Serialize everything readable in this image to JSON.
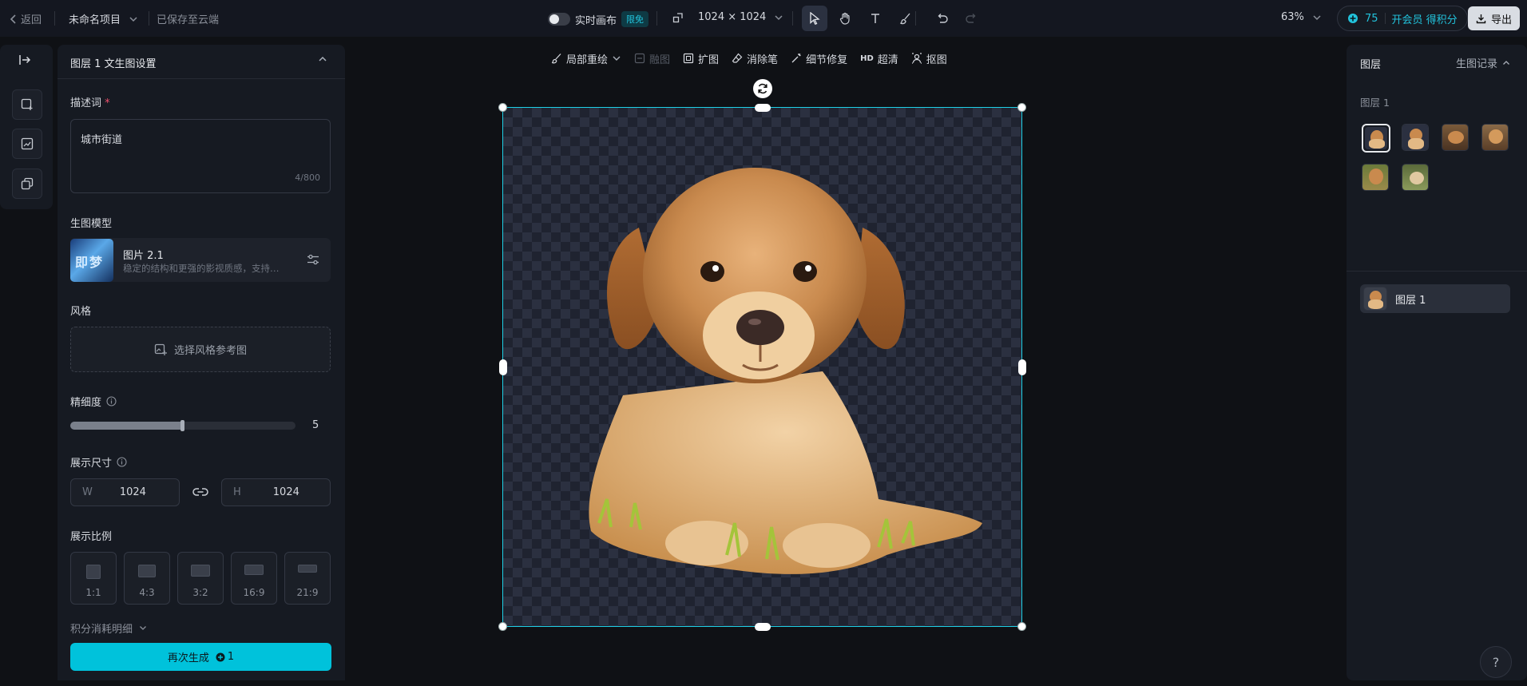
{
  "header": {
    "back_label": "返回",
    "project_name": "未命名项目",
    "save_status": "已保存至云端",
    "realtime_canvas_label": "实时画布",
    "free_badge": "限免",
    "canvas_size": "1024 × 1024",
    "zoom": "63%",
    "points": "75",
    "vip_label": "开会员 得积分",
    "export_label": "导出"
  },
  "left_panel": {
    "title": "图层 1 文生图设置",
    "prompt_label": "描述词",
    "required_mark": "*",
    "prompt_value": "城市街道",
    "prompt_count": "4/800",
    "model_label": "生图模型",
    "model_name": "图片 2.1",
    "model_desc": "稳定的结构和更强的影视质感，支持…",
    "model_thumb_text": "即梦",
    "style_label": "风格",
    "style_button": "选择风格参考图",
    "detail_label": "精细度",
    "detail_value": "5",
    "detail_fraction": 0.5,
    "size_label": "展示尺寸",
    "width_prefix": "W",
    "width_value": "1024",
    "height_prefix": "H",
    "height_value": "1024",
    "ratio_label": "展示比例",
    "ratios": [
      "1:1",
      "4:3",
      "3:2",
      "16:9",
      "21:9"
    ],
    "cost_detail_label": "积分消耗明细",
    "regenerate_label": "再次生成",
    "regenerate_cost": "1"
  },
  "canvas_toolbar": {
    "inpaint": "局部重绘",
    "merge": "融图",
    "expand": "扩图",
    "eraser": "消除笔",
    "detail_fix": "细节修复",
    "hd_badge": "HD",
    "upscale": "超清",
    "cutout": "抠图"
  },
  "right_panel": {
    "layers_tab": "图层",
    "history_tab": "生图记录",
    "layer_group_title": "图层 1",
    "layer_row_name": "图层 1"
  },
  "help_label": "?",
  "colors": {
    "accent": "#00c2db",
    "selection": "#1fd0e6",
    "background": "#0f1115",
    "panel": "#161a22"
  }
}
